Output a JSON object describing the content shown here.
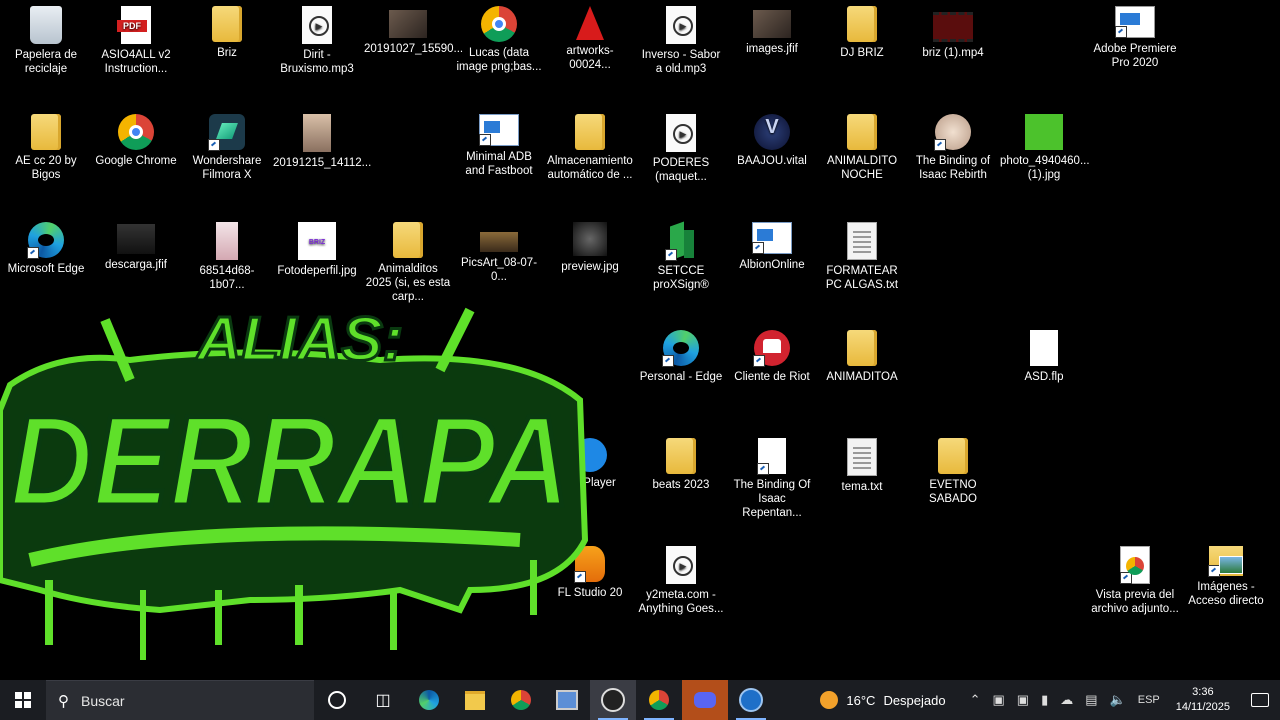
{
  "desktop_icons": [
    {
      "label": "Papelera de reciclaje",
      "kind": "recycle",
      "shortcut": false
    },
    {
      "label": "ASIO4ALL v2 Instruction...",
      "kind": "pdf",
      "shortcut": false
    },
    {
      "label": "Briz",
      "kind": "folder",
      "shortcut": false
    },
    {
      "label": "Dirit - Bruxismo.mp3",
      "kind": "media",
      "shortcut": false
    },
    {
      "label": "20191027_15590...",
      "kind": "photo",
      "shortcut": false
    },
    {
      "label": "Lucas (data image png;bas...",
      "kind": "chrome",
      "shortcut": false
    },
    {
      "label": "artworks-00024...",
      "kind": "vlc",
      "shortcut": false
    },
    {
      "label": "Inverso - Sabor a old.mp3",
      "kind": "media",
      "shortcut": false
    },
    {
      "label": "images.jfif",
      "kind": "photo",
      "shortcut": false
    },
    {
      "label": "DJ BRIZ",
      "kind": "folder",
      "shortcut": false
    },
    {
      "label": "briz (1).mp4",
      "kind": "video",
      "shortcut": false
    },
    {
      "label": "Adobe Premiere Pro 2020",
      "kind": "premiere",
      "shortcut": true
    },
    {
      "label": "AE cc 20 by Bigos",
      "kind": "folder",
      "shortcut": false
    },
    {
      "label": "Google Chrome",
      "kind": "chrome",
      "shortcut": false
    },
    {
      "label": "Wondershare Filmora X",
      "kind": "filmora",
      "shortcut": true
    },
    {
      "label": "20191215_14112...",
      "kind": "photo2",
      "shortcut": false
    },
    {
      "label": "Minimal ADB and Fastboot",
      "kind": "window",
      "shortcut": true
    },
    {
      "label": "Almacenamiento automático de ...",
      "kind": "folder",
      "shortcut": false
    },
    {
      "label": "PODERES (maquet...",
      "kind": "media",
      "shortcut": false
    },
    {
      "label": "BAAJOU.vital",
      "kind": "baajou",
      "shortcut": false
    },
    {
      "label": "ANIMALDITO NOCHE",
      "kind": "folder",
      "shortcut": false
    },
    {
      "label": "The Binding of Isaac Rebirth",
      "kind": "isaac",
      "shortcut": true
    },
    {
      "label": "photo_4940460... (1).jpg",
      "kind": "green",
      "shortcut": false
    },
    {
      "label": "Microsoft Edge",
      "kind": "edge",
      "shortcut": true
    },
    {
      "label": "descarga.jfif",
      "kind": "dark",
      "shortcut": false
    },
    {
      "label": "68514d68-1b07...",
      "kind": "pink",
      "shortcut": false
    },
    {
      "label": "Fotodeperfil.jpg",
      "kind": "briz",
      "shortcut": false
    },
    {
      "label": "Animalditos 2025 (si, es esta carp...",
      "kind": "folder",
      "shortcut": false
    },
    {
      "label": "PicsArt_08-07-0...",
      "kind": "picsart",
      "shortcut": false
    },
    {
      "label": "preview.jpg",
      "kind": "wolf",
      "shortcut": false
    },
    {
      "label": "SETCCE proXSign®",
      "kind": "setcce",
      "shortcut": true
    },
    {
      "label": "AlbionOnline",
      "kind": "window",
      "shortcut": true
    },
    {
      "label": "FORMATEAR PC ALGAS.txt",
      "kind": "doc",
      "shortcut": false
    },
    {
      "label": "Personal - Edge",
      "kind": "edge",
      "shortcut": true
    },
    {
      "label": "Cliente de Riot",
      "kind": "riot",
      "shortcut": true
    },
    {
      "label": "ANIMADITOA",
      "kind": "folder",
      "shortcut": false
    },
    {
      "label": "ASD.flp",
      "kind": "blank",
      "shortcut": false
    },
    {
      "label": "me Player",
      "kind": "qt",
      "shortcut": false
    },
    {
      "label": "beats 2023",
      "kind": "folder",
      "shortcut": false
    },
    {
      "label": "The Binding Of Isaac Repentan...",
      "kind": "blank",
      "shortcut": true
    },
    {
      "label": "tema.txt",
      "kind": "doc",
      "shortcut": false
    },
    {
      "label": "EVETNO SABADO",
      "kind": "folder",
      "shortcut": false
    },
    {
      "label": "FL Studio 20",
      "kind": "fl",
      "shortcut": true
    },
    {
      "label": "y2meta.com - Anything Goes...",
      "kind": "media",
      "shortcut": false
    },
    {
      "label": "Vista previa del archivo adjunto...",
      "kind": "htmlchrome",
      "shortcut": true
    },
    {
      "label": "Imágenes - Acceso directo",
      "kind": "imgfolder",
      "shortcut": true
    }
  ],
  "logo": {
    "line1": "ALIAS:",
    "line2": "DERRAPA"
  },
  "taskbar": {
    "search_placeholder": "Buscar",
    "weather_temp": "16°C",
    "weather_text": "Despejado",
    "language": "ESP",
    "time": "3:36",
    "date": "14/11/2025",
    "accent": "#7fb4ff"
  },
  "colors": {
    "logo_green": "#5fe02a",
    "logo_dark": "#0a3a10",
    "taskbar_bg": "#1b1d22"
  }
}
